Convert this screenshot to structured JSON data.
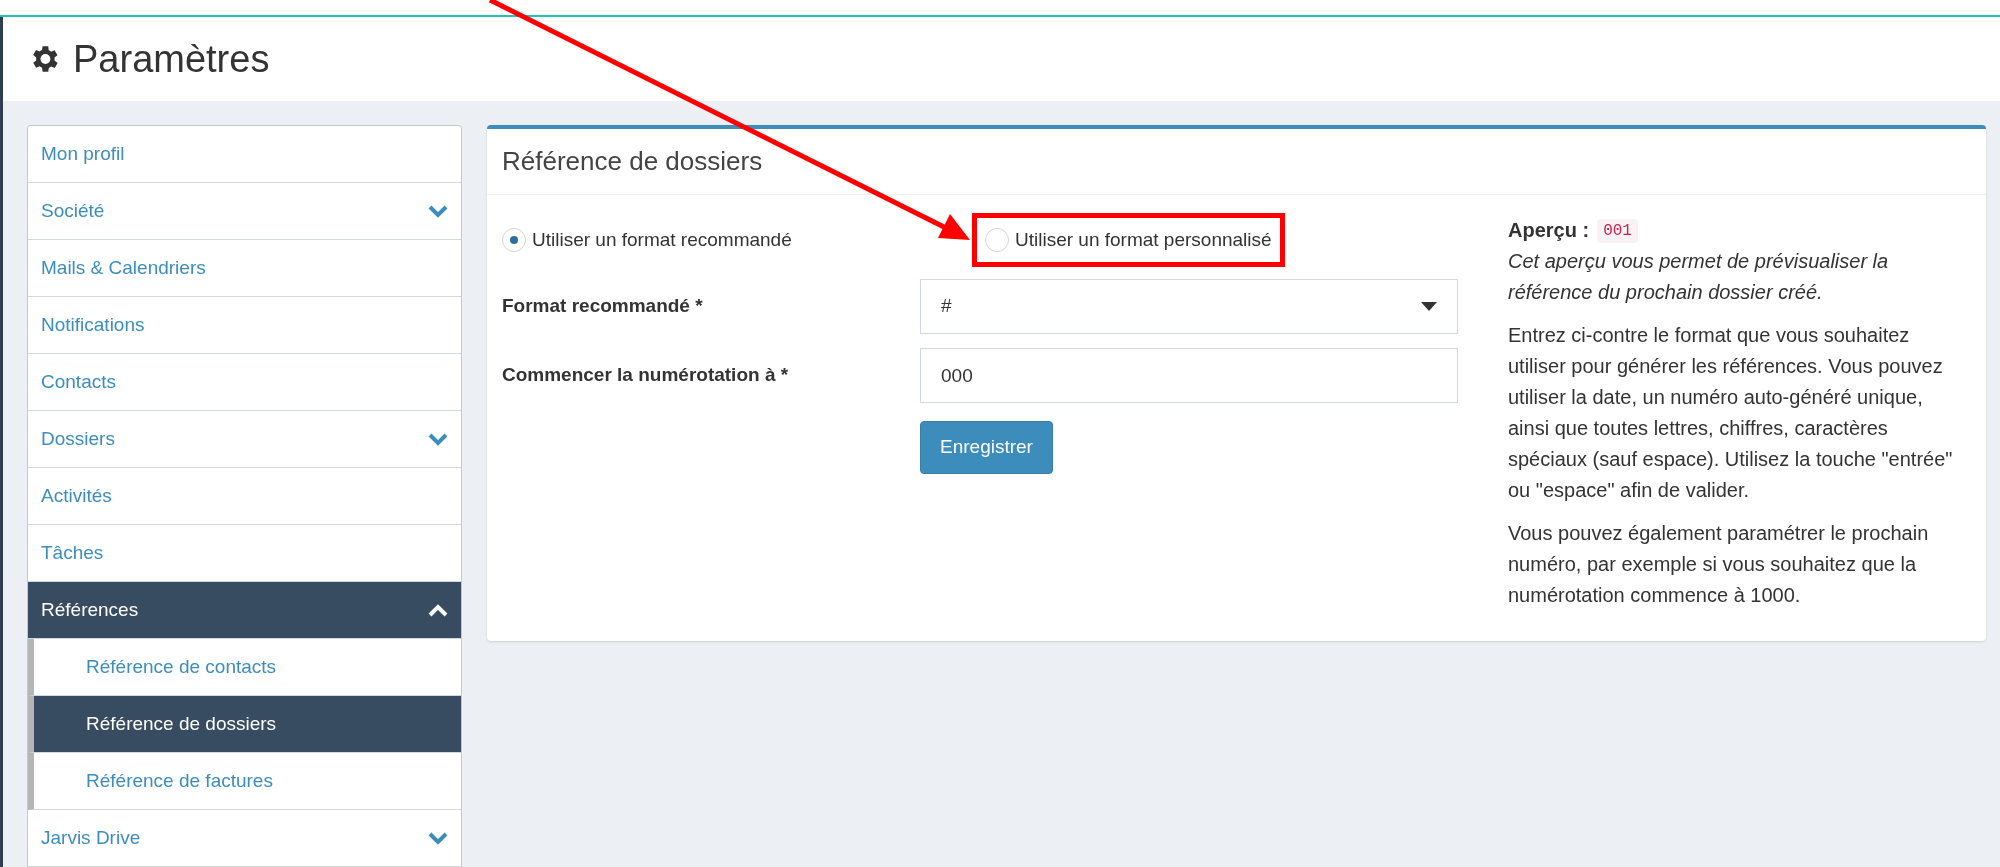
{
  "page": {
    "title": "Paramètres"
  },
  "sidebar": {
    "items": [
      {
        "label": "Mon profil",
        "kind": "link",
        "selected": false
      },
      {
        "label": "Société",
        "kind": "group",
        "selected": false,
        "expanded": false
      },
      {
        "label": "Mails & Calendriers",
        "kind": "link",
        "selected": false
      },
      {
        "label": "Notifications",
        "kind": "link",
        "selected": false
      },
      {
        "label": "Contacts",
        "kind": "link",
        "selected": false
      },
      {
        "label": "Dossiers",
        "kind": "group",
        "selected": false,
        "expanded": false
      },
      {
        "label": "Activités",
        "kind": "link",
        "selected": false
      },
      {
        "label": "Tâches",
        "kind": "link",
        "selected": false
      },
      {
        "label": "Références",
        "kind": "group",
        "selected": true,
        "expanded": true,
        "children": [
          {
            "label": "Référence de contacts",
            "selected": false
          },
          {
            "label": "Référence de dossiers",
            "selected": true
          },
          {
            "label": "Référence de factures",
            "selected": false
          }
        ]
      },
      {
        "label": "Jarvis Drive",
        "kind": "group",
        "selected": false,
        "expanded": false
      }
    ]
  },
  "panel": {
    "title": "Référence de dossiers",
    "format_options": [
      {
        "label": "Utiliser un format recommandé",
        "selected": true,
        "highlighted": false
      },
      {
        "label": "Utiliser un format personnalisé",
        "selected": false,
        "highlighted": true
      }
    ],
    "fields": [
      {
        "kind": "select",
        "label": "Format recommandé *",
        "value": "#"
      },
      {
        "kind": "input",
        "label": "Commencer la numérotation à *",
        "value": "000"
      }
    ],
    "save_button": "Enregistrer",
    "preview": {
      "label": "Aperçu :",
      "value": "001",
      "note": "Cet aperçu vous permet de prévisualiser la référence du prochain dossier créé."
    },
    "help": [
      "Entrez ci-contre le format que vous souhaitez utiliser pour générer les références. Vous pouvez utiliser la date, un numéro auto-généré unique, ainsi que toutes lettres, chiffres, caractères spéciaux (sauf espace). Utilisez la touche \"entrée\" ou \"espace\" afin de valider.",
      "Vous pouvez également paramétrer le prochain numéro, par exemple si vous souhaitez que la numérotation commence à 1000."
    ]
  }
}
